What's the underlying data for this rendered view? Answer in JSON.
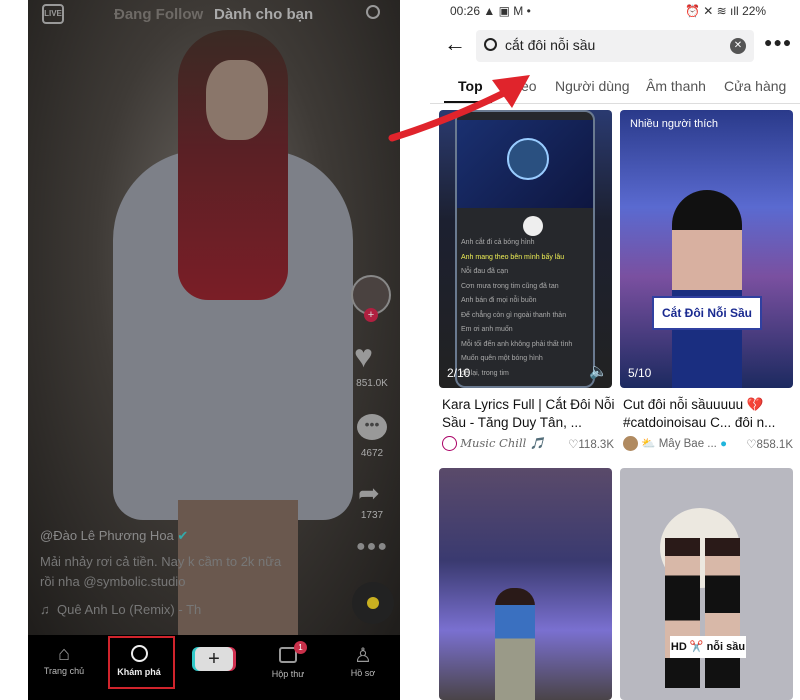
{
  "left_phone": {
    "top_nav": {
      "live": "LIVE",
      "following": "Đang Follow",
      "for_you": "Dành cho bạn"
    },
    "rail": {
      "likes": "851.0K",
      "comments": "4672",
      "shares": "1737"
    },
    "caption": {
      "author": "@Đào Lê Phương Hoa",
      "text_line1": "Mải nhảy rơi cả tiền. Nay k cầm to 2k nữa",
      "text_line2": "rồi nha @symbolic.studio",
      "music": "Quê Anh Lo (Remix) - Th"
    },
    "nav": [
      {
        "label": "Trang chủ",
        "icon": "home-icon"
      },
      {
        "label": "Khám phá",
        "icon": "search-icon",
        "highlighted": true
      },
      {
        "label": "",
        "icon": "plus-icon"
      },
      {
        "label": "Hộp thư",
        "icon": "inbox-icon",
        "badge": "1"
      },
      {
        "label": "Hồ sơ",
        "icon": "profile-icon"
      }
    ]
  },
  "right_phone": {
    "status": {
      "time": "00:26",
      "battery": "22%"
    },
    "search": {
      "value": "cắt đôi nỗi sầu"
    },
    "tabs": [
      "Top",
      "Video",
      "Người dùng",
      "Âm thanh",
      "Cửa hàng"
    ],
    "active_tab": "Top",
    "results": [
      {
        "title": "Kara Lyrics Full | Cắt Đôi Nỗi Sầu - Tăng Duy Tân, ...",
        "author": "Music Chill 🎵",
        "likes": "118.3K",
        "counter": "2/10",
        "lyrics": [
          "Anh cắt đi cả bóng hình",
          "Anh mang theo bên mình bấy lâu",
          "Nỗi đau đã cạn",
          "Cơn mưa trong tim cũng đã tan",
          "Anh bán đi mọi nỗi buồn",
          "Để chẳng còn gì ngoài thanh thản",
          "Em ơi anh muốn",
          "Mỗi tối đến anh không phải thất tình",
          "Muốn quên một bóng hình",
          "để lại, trong tim"
        ]
      },
      {
        "title": "Cut đôi nỗi sầuuuuu 💔 #catdoinoisau C... đôi n...",
        "author": "Mây Bae ...",
        "likes": "858.1K",
        "counter": "5/10",
        "badge": "Nhiều người thích",
        "overlay": "Cắt Đôi Nỗi Sầu"
      },
      {
        "title": "",
        "author": "",
        "likes": ""
      },
      {
        "title": "",
        "author": "",
        "likes": "",
        "overlay": "HD ✂️ nỗi sầu"
      }
    ]
  },
  "colors": {
    "accent": "#fe2c55",
    "annotation": "#e0242c",
    "verified": "#20d5ec"
  }
}
